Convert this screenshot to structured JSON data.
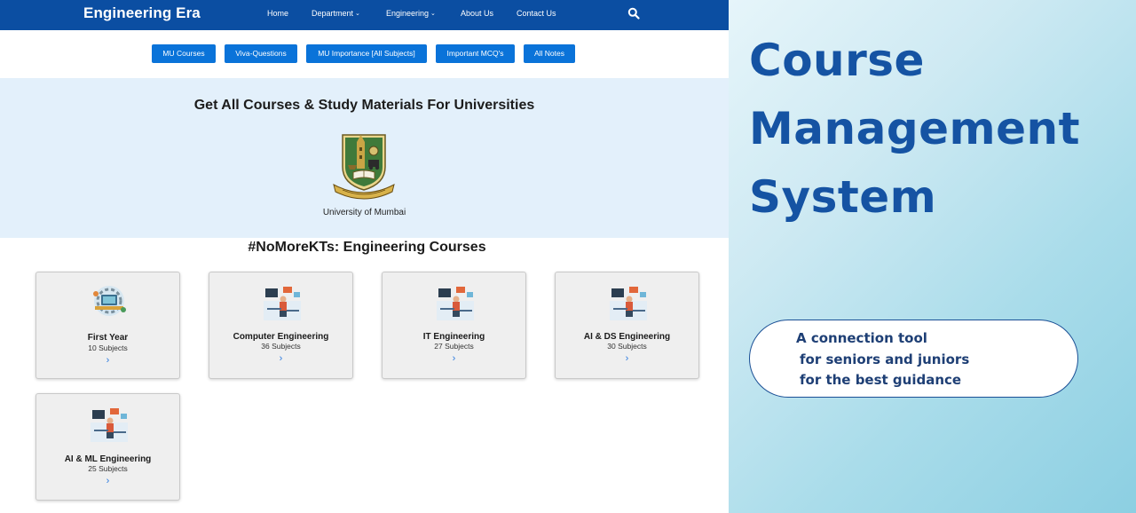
{
  "navbar": {
    "brand": "Engineering Era",
    "links": [
      {
        "label": "Home",
        "dropdown": false
      },
      {
        "label": "Department",
        "dropdown": true
      },
      {
        "label": "Engineering",
        "dropdown": true
      },
      {
        "label": "About Us",
        "dropdown": false
      },
      {
        "label": "Contact Us",
        "dropdown": false
      }
    ],
    "chevron": "⌄",
    "search_icon": "search-icon"
  },
  "quick_links": [
    "MU Courses",
    "Viva-Questions",
    "MU Importance [All Subjects]",
    "Important MCQ's",
    "All Notes"
  ],
  "hero": {
    "title": "Get All Courses & Study Materials For Universities",
    "university": "University of Mumbai"
  },
  "courses_section": {
    "title": "#NoMoreKTs: Engineering Courses",
    "cards": [
      {
        "title": "First Year",
        "subjects": "10 Subjects"
      },
      {
        "title": "Computer Engineering",
        "subjects": "36 Subjects"
      },
      {
        "title": "IT Engineering",
        "subjects": "27 Subjects"
      },
      {
        "title": "AI & DS Engineering",
        "subjects": "30 Subjects"
      },
      {
        "title": "AI & ML Engineering",
        "subjects": "25 Subjects"
      }
    ],
    "arrow": "›"
  },
  "promo": {
    "title_lines": [
      "Course",
      "Management",
      "System"
    ],
    "tagline_lines": [
      "A connection tool",
      "for seniors and juniors",
      "for the best guidance"
    ]
  },
  "colors": {
    "navbar": "#0b4ea2",
    "chip": "#0a73d9",
    "hero_bg": "#e3f0fb",
    "promo_title": "#1553a3"
  }
}
